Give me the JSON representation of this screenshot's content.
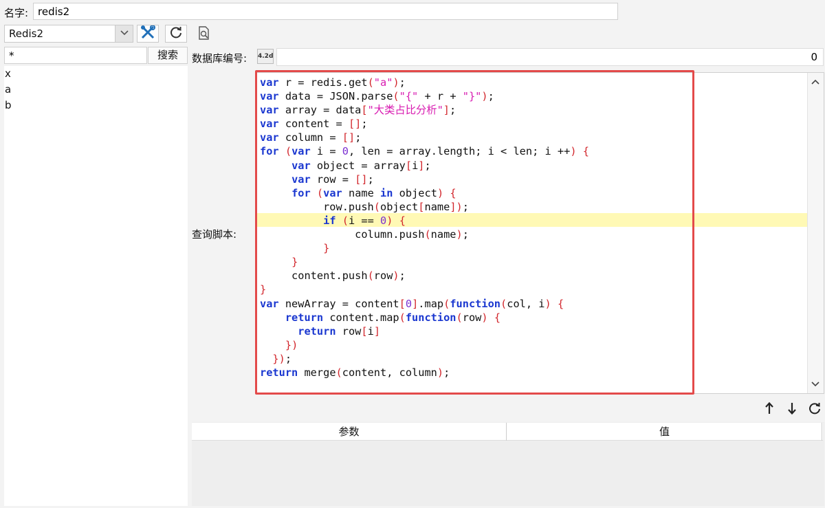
{
  "name_label": "名字:",
  "name_value": "redis2",
  "connection": {
    "selected": "Redis2",
    "arrow": "⌄"
  },
  "key_filter": "*",
  "search_label": "搜索",
  "keys": [
    "x",
    "a",
    "b"
  ],
  "db_label": "数据库编号:",
  "db_icon_text": "4.2d",
  "db_value": "0",
  "script_label": "查询脚本:",
  "params_table": {
    "col_param": "参数",
    "col_value": "值"
  },
  "icons": {
    "tools": "wrench-screwdriver-icon",
    "refresh": "refresh-icon",
    "inspect": "document-search-icon",
    "up": "arrow-up-icon",
    "down": "arrow-down-icon",
    "reload": "reload-icon"
  },
  "colors": {
    "keyword": "#1a37d0",
    "string": "#d81bb1",
    "number": "#7a2fd1",
    "punct": "#d2262c",
    "highlight": "#fff9b5",
    "frame": "#e34a4a"
  },
  "code_lines": [
    "var r = redis.get(\"a\");",
    "var data = JSON.parse(\"{\" + r + \"}\");",
    "var array = data[\"大类占比分析\"];",
    "var content = [];",
    "var column = [];",
    "for (var i = 0, len = array.length; i < len; i ++) {",
    "     var object = array[i];",
    "     var row = [];",
    "     for (var name in object) {",
    "          row.push(object[name]);",
    "          if (i == 0) {",
    "               column.push(name);",
    "          }",
    "     }",
    "     content.push(row);",
    "}",
    "var newArray = content[0].map(function(col, i) {",
    "    return content.map(function(row) {",
    "      return row[i]",
    "    })",
    "  });",
    "return merge(content, column);"
  ]
}
